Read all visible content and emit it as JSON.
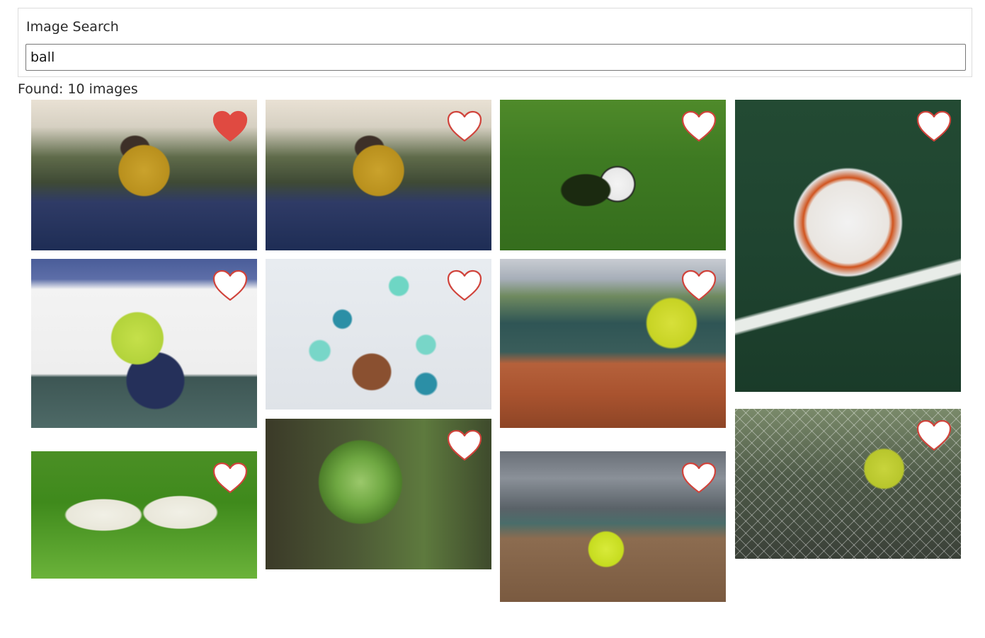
{
  "search": {
    "title": "Image Search",
    "query": "ball"
  },
  "results": {
    "found_label": "Found: 10 images"
  },
  "images": [
    {
      "id": "man-holding-ball-1",
      "favorited": true
    },
    {
      "id": "man-holding-ball-2",
      "favorited": false
    },
    {
      "id": "soccer-ball-grass",
      "favorited": false
    },
    {
      "id": "soccer-ball-turf",
      "favorited": false
    },
    {
      "id": "tennis-ball-court",
      "favorited": false
    },
    {
      "id": "dog-balloons",
      "favorited": false
    },
    {
      "id": "tennis-ball-clay",
      "favorited": false
    },
    {
      "id": "eggs-grass",
      "favorited": false
    },
    {
      "id": "fern-curl",
      "favorited": false
    },
    {
      "id": "tennis-ball-indoor",
      "favorited": false
    },
    {
      "id": "tennis-racket-ball",
      "favorited": false
    }
  ],
  "colors": {
    "heart_active": "#e04a41",
    "heart_outline": "#d0433b"
  }
}
